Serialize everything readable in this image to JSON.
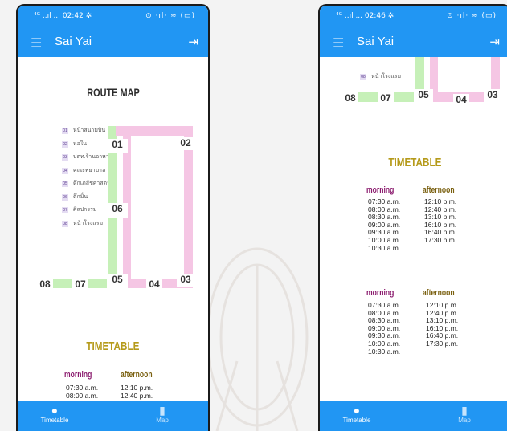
{
  "screens": [
    {
      "status": {
        "time_left": "⁴ᴳ ..ıl  ... 02:42 ✲",
        "icons_right": "⊙ ·ıl· ≈ (▭)"
      },
      "app": {
        "title": "Sai Yai"
      },
      "route_map": {
        "title": "ROUTE MAP",
        "stations": [
          {
            "num": "01",
            "name": "หน้าสนามบิน"
          },
          {
            "num": "02",
            "name": "หอใน"
          },
          {
            "num": "03",
            "name": "ปตท.ร้านอาหาร"
          },
          {
            "num": "04",
            "name": "คณะพยาบาล"
          },
          {
            "num": "05",
            "name": "ตึกเภสัชศาสตร์"
          },
          {
            "num": "06",
            "name": "ตึกมิ้น"
          },
          {
            "num": "07",
            "name": "ศิลปกรรม"
          },
          {
            "num": "08",
            "name": "หน้าโรงแรม"
          }
        ],
        "stop_labels": [
          "01",
          "02",
          "06",
          "08",
          "07",
          "05",
          "04",
          "03"
        ]
      },
      "timetable": {
        "title": "TIMETABLE",
        "tables": [
          {
            "morning_header": "morning",
            "afternoon_header": "afternoon",
            "morning": [
              "07:30 a.m.",
              "08:00 a.m."
            ],
            "afternoon": [
              "12:10 p.m.",
              "12:40 p.m."
            ]
          }
        ]
      },
      "nav": {
        "timetable": "Timetable",
        "map": "Map",
        "timetable_icon": "●",
        "map_icon": "▮"
      }
    },
    {
      "status": {
        "time_left": "⁴ᴳ ..ıl  ... 02:46 ✲",
        "icons_right": "⊙ ·ıl· ≈ (▭)"
      },
      "app": {
        "title": "Sai Yai"
      },
      "route_map": {
        "stations": [
          {
            "num": "08",
            "name": "หน้าโรงแรม"
          }
        ],
        "stop_labels": [
          "08",
          "07",
          "05",
          "04",
          "03"
        ]
      },
      "timetable": {
        "title": "TIMETABLE",
        "tables": [
          {
            "morning_header": "morning",
            "afternoon_header": "afternoon",
            "morning": [
              "07:30 a.m.",
              "08:00 a.m.",
              "08:30 a.m.",
              "09:00 a.m.",
              "09:30 a.m.",
              "10:00 a.m.",
              "10:30 a.m."
            ],
            "afternoon": [
              "12:10 p.m.",
              "12:40 p.m.",
              "13:10 p.m.",
              "16:10 p.m.",
              "16:40 p.m.",
              "17:30 p.m."
            ]
          },
          {
            "morning_header": "morning",
            "afternoon_header": "afternoon",
            "morning": [
              "07:30 a.m.",
              "08:00 a.m.",
              "08:30 a.m.",
              "09:00 a.m.",
              "09:30 a.m.",
              "10:00 a.m.",
              "10:30 a.m."
            ],
            "afternoon": [
              "12:10 p.m.",
              "12:40 p.m.",
              "13:10 p.m.",
              "16:10 p.m.",
              "16:40 p.m.",
              "17:30 p.m."
            ]
          }
        ]
      },
      "nav": {
        "timetable": "Timetable",
        "map": "Map",
        "timetable_icon": "●",
        "map_icon": "▮"
      }
    }
  ],
  "colors": {
    "appbar": "#2196f3",
    "route_green": "#c6f0b8",
    "route_pink": "#f5c6e4",
    "morning": "#8a1a6d",
    "afternoon": "#7a6010",
    "timetable_title": "#b59a1a"
  }
}
